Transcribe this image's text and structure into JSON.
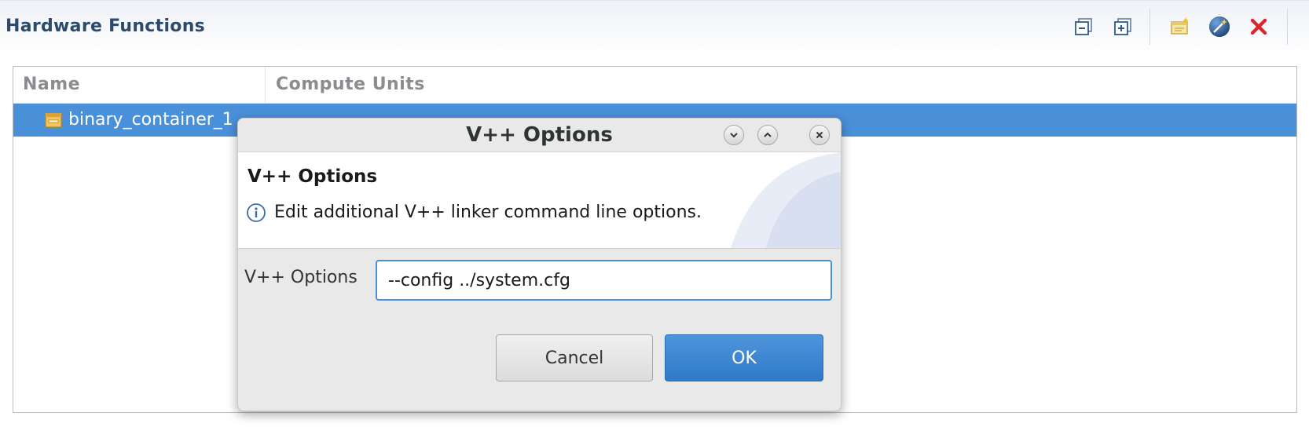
{
  "section": {
    "title": "Hardware Functions"
  },
  "toolbar": {
    "icons": [
      "collapse-all-icon",
      "expand-all-icon",
      "add-function-icon",
      "wand-icon",
      "remove-icon"
    ]
  },
  "table": {
    "columns": [
      "Name",
      "Compute Units"
    ],
    "rows": [
      {
        "name": "binary_container_1",
        "compute_units": "",
        "selected": true
      }
    ]
  },
  "dialog": {
    "title": "V++ Options",
    "banner_title": "V++ Options",
    "banner_description": "Edit additional V++ linker command line options.",
    "field_label": "V++ Options",
    "field_value": "--config ../system.cfg",
    "cancel_label": "Cancel",
    "ok_label": "OK"
  },
  "colors": {
    "selection": "#4a90d9",
    "header_title": "#2c4a6b",
    "ok_button": "#3a84d2"
  }
}
